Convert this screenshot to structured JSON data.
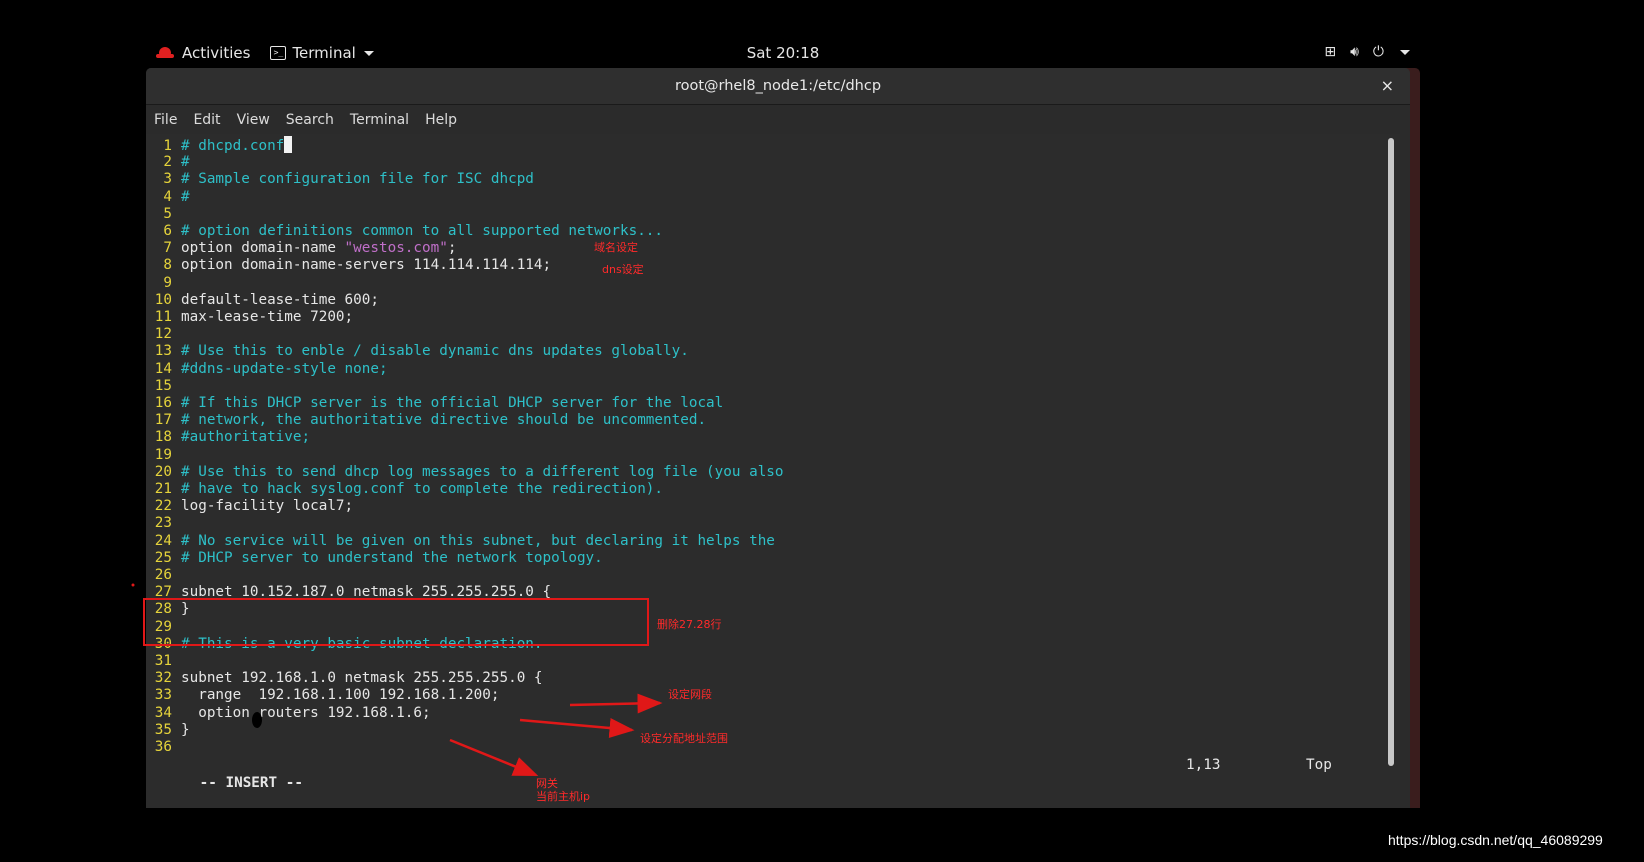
{
  "topbar": {
    "activities": "Activities",
    "app": "Terminal",
    "clock": "Sat 20:18",
    "tray": {
      "network": "network-icon",
      "volume": "volume-icon",
      "power": "power-icon"
    }
  },
  "window": {
    "title": "root@rhel8_node1:/etc/dhcp",
    "close": "×",
    "menu": [
      "File",
      "Edit",
      "View",
      "Search",
      "Terminal",
      "Help"
    ]
  },
  "editor": {
    "lines": [
      {
        "n": "1",
        "t": "# dhcpd.conf",
        "k": "c"
      },
      {
        "n": "2",
        "t": "#",
        "k": "c"
      },
      {
        "n": "3",
        "t": "# Sample configuration file for ISC dhcpd",
        "k": "c"
      },
      {
        "n": "4",
        "t": "#",
        "k": "c"
      },
      {
        "n": "5",
        "t": "",
        "k": "t"
      },
      {
        "n": "6",
        "t": "# option definitions common to all supported networks...",
        "k": "c"
      },
      {
        "n": "7",
        "t": "option domain-name ",
        "k": "t",
        "s": "\"westos.com\"",
        "e": ";"
      },
      {
        "n": "8",
        "t": "option domain-name-servers 114.114.114.114;",
        "k": "t"
      },
      {
        "n": "9",
        "t": "",
        "k": "t"
      },
      {
        "n": "10",
        "t": "default-lease-time 600;",
        "k": "t"
      },
      {
        "n": "11",
        "t": "max-lease-time 7200;",
        "k": "t"
      },
      {
        "n": "12",
        "t": "",
        "k": "t"
      },
      {
        "n": "13",
        "t": "# Use this to enble / disable dynamic dns updates globally.",
        "k": "c"
      },
      {
        "n": "14",
        "t": "#ddns-update-style none;",
        "k": "c"
      },
      {
        "n": "15",
        "t": "",
        "k": "t"
      },
      {
        "n": "16",
        "t": "# If this DHCP server is the official DHCP server for the local",
        "k": "c"
      },
      {
        "n": "17",
        "t": "# network, the authoritative directive should be uncommented.",
        "k": "c"
      },
      {
        "n": "18",
        "t": "#authoritative;",
        "k": "c"
      },
      {
        "n": "19",
        "t": "",
        "k": "t"
      },
      {
        "n": "20",
        "t": "# Use this to send dhcp log messages to a different log file (you also",
        "k": "c"
      },
      {
        "n": "21",
        "t": "# have to hack syslog.conf to complete the redirection).",
        "k": "c"
      },
      {
        "n": "22",
        "t": "log-facility local7;",
        "k": "t"
      },
      {
        "n": "23",
        "t": "",
        "k": "t"
      },
      {
        "n": "24",
        "t": "# No service will be given on this subnet, but declaring it helps the",
        "k": "c"
      },
      {
        "n": "25",
        "t": "# DHCP server to understand the network topology.",
        "k": "c"
      },
      {
        "n": "26",
        "t": "",
        "k": "t"
      },
      {
        "n": "27",
        "t": "subnet 10.152.187.0 netmask 255.255.255.0 {",
        "k": "t"
      },
      {
        "n": "28",
        "t": "}",
        "k": "t"
      },
      {
        "n": "29",
        "t": "",
        "k": "t"
      },
      {
        "n": "30",
        "t": "# This is a very basic subnet declaration.",
        "k": "c"
      },
      {
        "n": "31",
        "t": "",
        "k": "t"
      },
      {
        "n": "32",
        "t": "subnet 192.168.1.0 netmask 255.255.255.0 {",
        "k": "t"
      },
      {
        "n": "33",
        "t": "  range  192.168.1.100 192.168.1.200;",
        "k": "t"
      },
      {
        "n": "34",
        "t": "  option routers 192.168.1.6;",
        "k": "t"
      },
      {
        "n": "35",
        "t": "}",
        "k": "t"
      },
      {
        "n": "36",
        "t": "",
        "k": "t"
      }
    ],
    "mode": "-- INSERT --",
    "position": "1,13",
    "scroll": "Top"
  },
  "annotations": {
    "domain": "域名设定",
    "dns": "dns设定",
    "delete": "删除27.28行",
    "subnet": "设定网段",
    "range": "设定分配地址范围",
    "gateway": "网关",
    "host_ip": "当前主机ip"
  },
  "watermark": "https://blog.csdn.net/qq_46089299",
  "colors": {
    "comment": "#2ec0c8",
    "line_number": "#e5d33b",
    "string": "#c06fc9",
    "annotation": "#ff2a2a"
  }
}
